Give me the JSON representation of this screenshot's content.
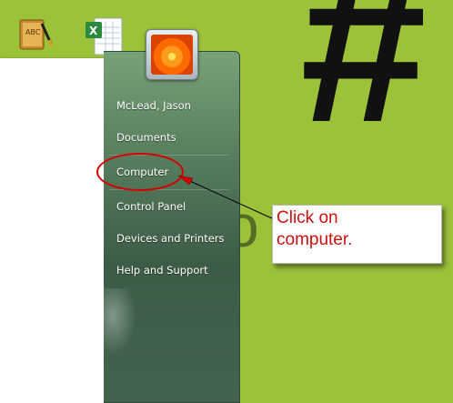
{
  "desktop": {
    "wallpaper_color": "#9cc23a",
    "wallpaper_text": "#",
    "wallpaper_word": "Yo"
  },
  "desktop_icons": [
    {
      "name": "dictionary-abc-icon"
    },
    {
      "name": "excel-file-icon"
    }
  ],
  "start_menu": {
    "user_picture": "orange-flower-avatar",
    "right_items": [
      {
        "label": "McLead, Jason"
      },
      {
        "label": "Documents"
      },
      {
        "label": "Computer"
      },
      {
        "label": "Control Panel"
      },
      {
        "label": "Devices and Printers"
      },
      {
        "label": "Help and Support"
      }
    ]
  },
  "annotation": {
    "callout_text": "Click on\ncomputer.",
    "color": "#d40000"
  }
}
